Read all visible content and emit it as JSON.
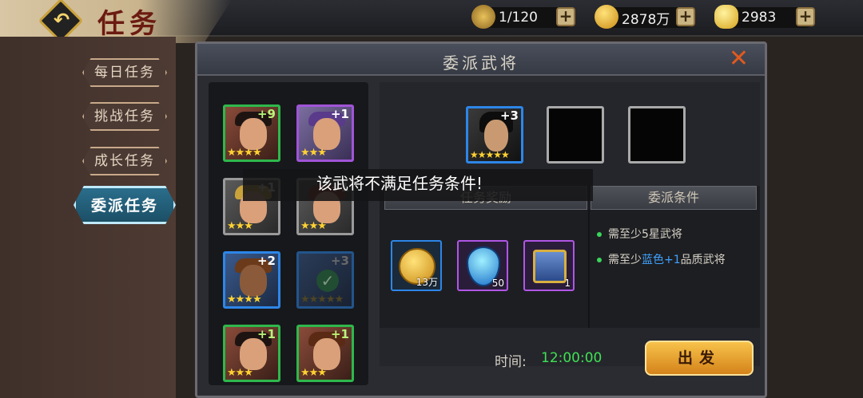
{
  "header": {
    "title": "任务",
    "back_icon": "back-arrow-icon",
    "resources": [
      {
        "icon": "stamina-icon",
        "value": "1/120"
      },
      {
        "icon": "gold-coin-icon",
        "value": "2878万"
      },
      {
        "icon": "ingot-icon",
        "value": "2983"
      }
    ],
    "plus_label": "+"
  },
  "nav": {
    "items": [
      {
        "label": "每日任务",
        "active": false
      },
      {
        "label": "挑战任务",
        "active": false
      },
      {
        "label": "成长任务",
        "active": false
      },
      {
        "label": "委派任务",
        "active": true
      }
    ]
  },
  "dialog": {
    "title": "委派武将",
    "close_icon": "close-icon",
    "heroes": [
      {
        "level": "+9",
        "stars": "★★★★",
        "quality": "green"
      },
      {
        "level": "+1",
        "stars": "★★★",
        "quality": "purple"
      },
      {
        "level": "+1",
        "stars": "★★★",
        "quality": "gray"
      },
      {
        "level": "+1",
        "stars": "★★★",
        "quality": "gray"
      },
      {
        "level": "+2",
        "stars": "★★★★",
        "quality": "blue"
      },
      {
        "level": "+3",
        "stars": "★★★★★",
        "quality": "blue",
        "selected": true
      },
      {
        "level": "+1",
        "stars": "★★★",
        "quality": "green"
      },
      {
        "level": "+1",
        "stars": "★★★",
        "quality": "green"
      }
    ],
    "slots": [
      {
        "level": "+3",
        "stars": "★★★★★",
        "filled": true
      },
      {
        "filled": false
      },
      {
        "filled": false
      }
    ],
    "reward_header": "任务奖励",
    "condition_header": "委派条件",
    "rewards": [
      {
        "icon": "gold-coin-icon",
        "qty": "13万"
      },
      {
        "icon": "gem-icon",
        "qty": "50"
      },
      {
        "icon": "chest-icon",
        "qty": "1"
      }
    ],
    "conditions": [
      {
        "prefix": "需至少5星武将",
        "highlight": "",
        "suffix": ""
      },
      {
        "prefix": "需至少",
        "highlight": "蓝色+1",
        "suffix": "品质武将"
      }
    ],
    "time_label": "时间:",
    "time_value": "12:00:00",
    "go_label": "出发",
    "check_icon": "✓"
  },
  "toast": {
    "message": "该武将不满足任务条件!"
  }
}
